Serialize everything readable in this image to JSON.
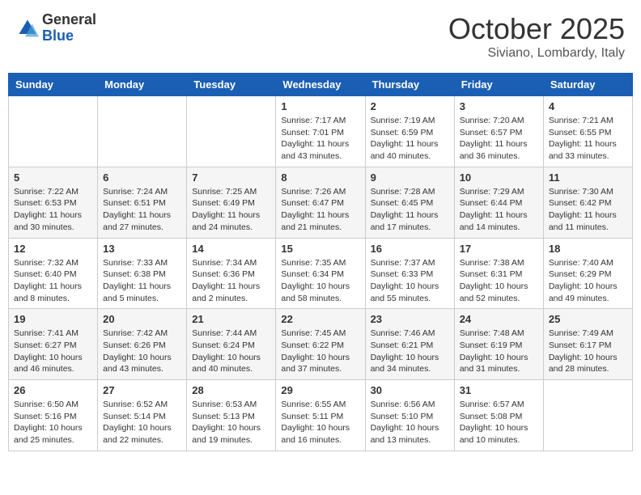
{
  "header": {
    "logo": {
      "general": "General",
      "blue": "Blue"
    },
    "title": "October 2025",
    "location": "Siviano, Lombardy, Italy"
  },
  "weekdays": [
    "Sunday",
    "Monday",
    "Tuesday",
    "Wednesday",
    "Thursday",
    "Friday",
    "Saturday"
  ],
  "weeks": [
    [
      {
        "day": "",
        "sunrise": "",
        "sunset": "",
        "daylight": ""
      },
      {
        "day": "",
        "sunrise": "",
        "sunset": "",
        "daylight": ""
      },
      {
        "day": "",
        "sunrise": "",
        "sunset": "",
        "daylight": ""
      },
      {
        "day": "1",
        "sunrise": "Sunrise: 7:17 AM",
        "sunset": "Sunset: 7:01 PM",
        "daylight": "Daylight: 11 hours and 43 minutes."
      },
      {
        "day": "2",
        "sunrise": "Sunrise: 7:19 AM",
        "sunset": "Sunset: 6:59 PM",
        "daylight": "Daylight: 11 hours and 40 minutes."
      },
      {
        "day": "3",
        "sunrise": "Sunrise: 7:20 AM",
        "sunset": "Sunset: 6:57 PM",
        "daylight": "Daylight: 11 hours and 36 minutes."
      },
      {
        "day": "4",
        "sunrise": "Sunrise: 7:21 AM",
        "sunset": "Sunset: 6:55 PM",
        "daylight": "Daylight: 11 hours and 33 minutes."
      }
    ],
    [
      {
        "day": "5",
        "sunrise": "Sunrise: 7:22 AM",
        "sunset": "Sunset: 6:53 PM",
        "daylight": "Daylight: 11 hours and 30 minutes."
      },
      {
        "day": "6",
        "sunrise": "Sunrise: 7:24 AM",
        "sunset": "Sunset: 6:51 PM",
        "daylight": "Daylight: 11 hours and 27 minutes."
      },
      {
        "day": "7",
        "sunrise": "Sunrise: 7:25 AM",
        "sunset": "Sunset: 6:49 PM",
        "daylight": "Daylight: 11 hours and 24 minutes."
      },
      {
        "day": "8",
        "sunrise": "Sunrise: 7:26 AM",
        "sunset": "Sunset: 6:47 PM",
        "daylight": "Daylight: 11 hours and 21 minutes."
      },
      {
        "day": "9",
        "sunrise": "Sunrise: 7:28 AM",
        "sunset": "Sunset: 6:45 PM",
        "daylight": "Daylight: 11 hours and 17 minutes."
      },
      {
        "day": "10",
        "sunrise": "Sunrise: 7:29 AM",
        "sunset": "Sunset: 6:44 PM",
        "daylight": "Daylight: 11 hours and 14 minutes."
      },
      {
        "day": "11",
        "sunrise": "Sunrise: 7:30 AM",
        "sunset": "Sunset: 6:42 PM",
        "daylight": "Daylight: 11 hours and 11 minutes."
      }
    ],
    [
      {
        "day": "12",
        "sunrise": "Sunrise: 7:32 AM",
        "sunset": "Sunset: 6:40 PM",
        "daylight": "Daylight: 11 hours and 8 minutes."
      },
      {
        "day": "13",
        "sunrise": "Sunrise: 7:33 AM",
        "sunset": "Sunset: 6:38 PM",
        "daylight": "Daylight: 11 hours and 5 minutes."
      },
      {
        "day": "14",
        "sunrise": "Sunrise: 7:34 AM",
        "sunset": "Sunset: 6:36 PM",
        "daylight": "Daylight: 11 hours and 2 minutes."
      },
      {
        "day": "15",
        "sunrise": "Sunrise: 7:35 AM",
        "sunset": "Sunset: 6:34 PM",
        "daylight": "Daylight: 10 hours and 58 minutes."
      },
      {
        "day": "16",
        "sunrise": "Sunrise: 7:37 AM",
        "sunset": "Sunset: 6:33 PM",
        "daylight": "Daylight: 10 hours and 55 minutes."
      },
      {
        "day": "17",
        "sunrise": "Sunrise: 7:38 AM",
        "sunset": "Sunset: 6:31 PM",
        "daylight": "Daylight: 10 hours and 52 minutes."
      },
      {
        "day": "18",
        "sunrise": "Sunrise: 7:40 AM",
        "sunset": "Sunset: 6:29 PM",
        "daylight": "Daylight: 10 hours and 49 minutes."
      }
    ],
    [
      {
        "day": "19",
        "sunrise": "Sunrise: 7:41 AM",
        "sunset": "Sunset: 6:27 PM",
        "daylight": "Daylight: 10 hours and 46 minutes."
      },
      {
        "day": "20",
        "sunrise": "Sunrise: 7:42 AM",
        "sunset": "Sunset: 6:26 PM",
        "daylight": "Daylight: 10 hours and 43 minutes."
      },
      {
        "day": "21",
        "sunrise": "Sunrise: 7:44 AM",
        "sunset": "Sunset: 6:24 PM",
        "daylight": "Daylight: 10 hours and 40 minutes."
      },
      {
        "day": "22",
        "sunrise": "Sunrise: 7:45 AM",
        "sunset": "Sunset: 6:22 PM",
        "daylight": "Daylight: 10 hours and 37 minutes."
      },
      {
        "day": "23",
        "sunrise": "Sunrise: 7:46 AM",
        "sunset": "Sunset: 6:21 PM",
        "daylight": "Daylight: 10 hours and 34 minutes."
      },
      {
        "day": "24",
        "sunrise": "Sunrise: 7:48 AM",
        "sunset": "Sunset: 6:19 PM",
        "daylight": "Daylight: 10 hours and 31 minutes."
      },
      {
        "day": "25",
        "sunrise": "Sunrise: 7:49 AM",
        "sunset": "Sunset: 6:17 PM",
        "daylight": "Daylight: 10 hours and 28 minutes."
      }
    ],
    [
      {
        "day": "26",
        "sunrise": "Sunrise: 6:50 AM",
        "sunset": "Sunset: 5:16 PM",
        "daylight": "Daylight: 10 hours and 25 minutes."
      },
      {
        "day": "27",
        "sunrise": "Sunrise: 6:52 AM",
        "sunset": "Sunset: 5:14 PM",
        "daylight": "Daylight: 10 hours and 22 minutes."
      },
      {
        "day": "28",
        "sunrise": "Sunrise: 6:53 AM",
        "sunset": "Sunset: 5:13 PM",
        "daylight": "Daylight: 10 hours and 19 minutes."
      },
      {
        "day": "29",
        "sunrise": "Sunrise: 6:55 AM",
        "sunset": "Sunset: 5:11 PM",
        "daylight": "Daylight: 10 hours and 16 minutes."
      },
      {
        "day": "30",
        "sunrise": "Sunrise: 6:56 AM",
        "sunset": "Sunset: 5:10 PM",
        "daylight": "Daylight: 10 hours and 13 minutes."
      },
      {
        "day": "31",
        "sunrise": "Sunrise: 6:57 AM",
        "sunset": "Sunset: 5:08 PM",
        "daylight": "Daylight: 10 hours and 10 minutes."
      },
      {
        "day": "",
        "sunrise": "",
        "sunset": "",
        "daylight": ""
      }
    ]
  ]
}
